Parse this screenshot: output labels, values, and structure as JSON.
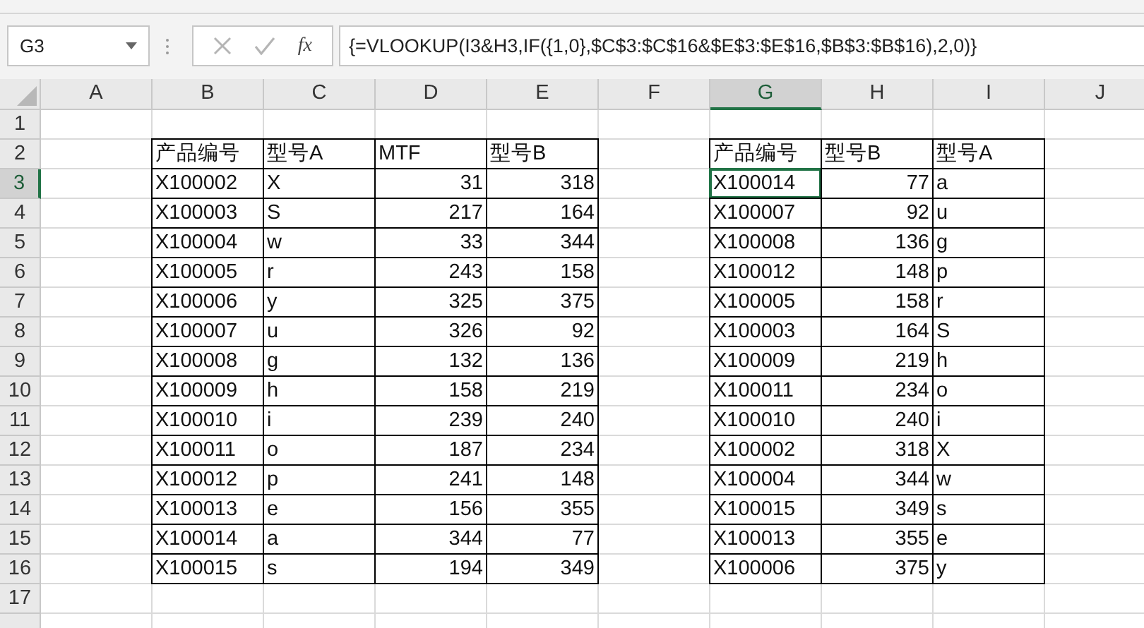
{
  "name_box": {
    "value": "G3"
  },
  "formula_bar": {
    "function_label": "fx",
    "formula": "{=VLOOKUP(I3&H3,IF({1,0},$C$3:$C$16&$E$3:$E$16,$B$3:$B$16),2,0)}"
  },
  "columns": [
    {
      "label": "A",
      "selected": false
    },
    {
      "label": "B",
      "selected": false
    },
    {
      "label": "C",
      "selected": false
    },
    {
      "label": "D",
      "selected": false
    },
    {
      "label": "E",
      "selected": false
    },
    {
      "label": "F",
      "selected": false
    },
    {
      "label": "G",
      "selected": true
    },
    {
      "label": "H",
      "selected": false
    },
    {
      "label": "I",
      "selected": false
    },
    {
      "label": "J",
      "selected": false
    }
  ],
  "row_numbers": [
    {
      "label": "1",
      "selected": false
    },
    {
      "label": "2",
      "selected": false
    },
    {
      "label": "3",
      "selected": true
    },
    {
      "label": "4",
      "selected": false
    },
    {
      "label": "5",
      "selected": false
    },
    {
      "label": "6",
      "selected": false
    },
    {
      "label": "7",
      "selected": false
    },
    {
      "label": "8",
      "selected": false
    },
    {
      "label": "9",
      "selected": false
    },
    {
      "label": "10",
      "selected": false
    },
    {
      "label": "11",
      "selected": false
    },
    {
      "label": "12",
      "selected": false
    },
    {
      "label": "13",
      "selected": false
    },
    {
      "label": "14",
      "selected": false
    },
    {
      "label": "15",
      "selected": false
    },
    {
      "label": "16",
      "selected": false
    },
    {
      "label": "17",
      "selected": false
    }
  ],
  "left_table": {
    "headers": [
      {
        "text": "产品编号",
        "kind": "text"
      },
      {
        "text": "型号A",
        "kind": "text"
      },
      {
        "text": "MTF",
        "kind": "number"
      },
      {
        "text": "型号B",
        "kind": "number"
      }
    ],
    "rows": [
      [
        "X100002",
        "X",
        "31",
        "318"
      ],
      [
        "X100003",
        "S",
        "217",
        "164"
      ],
      [
        "X100004",
        "w",
        "33",
        "344"
      ],
      [
        "X100005",
        "r",
        "243",
        "158"
      ],
      [
        "X100006",
        "y",
        "325",
        "375"
      ],
      [
        "X100007",
        "u",
        "326",
        "92"
      ],
      [
        "X100008",
        "g",
        "132",
        "136"
      ],
      [
        "X100009",
        "h",
        "158",
        "219"
      ],
      [
        "X100010",
        "i",
        "239",
        "240"
      ],
      [
        "X100011",
        "o",
        "187",
        "234"
      ],
      [
        "X100012",
        "p",
        "241",
        "148"
      ],
      [
        "X100013",
        "e",
        "156",
        "355"
      ],
      [
        "X100014",
        "a",
        "344",
        "77"
      ],
      [
        "X100015",
        "s",
        "194",
        "349"
      ]
    ]
  },
  "right_table": {
    "headers": [
      {
        "text": "产品编号",
        "kind": "text"
      },
      {
        "text": "型号B",
        "kind": "number"
      },
      {
        "text": "型号A",
        "kind": "text"
      }
    ],
    "rows": [
      [
        "X100014",
        "77",
        "a"
      ],
      [
        "X100007",
        "92",
        "u"
      ],
      [
        "X100008",
        "136",
        "g"
      ],
      [
        "X100012",
        "148",
        "p"
      ],
      [
        "X100005",
        "158",
        "r"
      ],
      [
        "X100003",
        "164",
        "S"
      ],
      [
        "X100009",
        "219",
        "h"
      ],
      [
        "X100011",
        "234",
        "o"
      ],
      [
        "X100010",
        "240",
        "i"
      ],
      [
        "X100002",
        "318",
        "X"
      ],
      [
        "X100004",
        "344",
        "w"
      ],
      [
        "X100015",
        "349",
        "s"
      ],
      [
        "X100013",
        "355",
        "e"
      ],
      [
        "X100006",
        "375",
        "y"
      ]
    ]
  }
}
